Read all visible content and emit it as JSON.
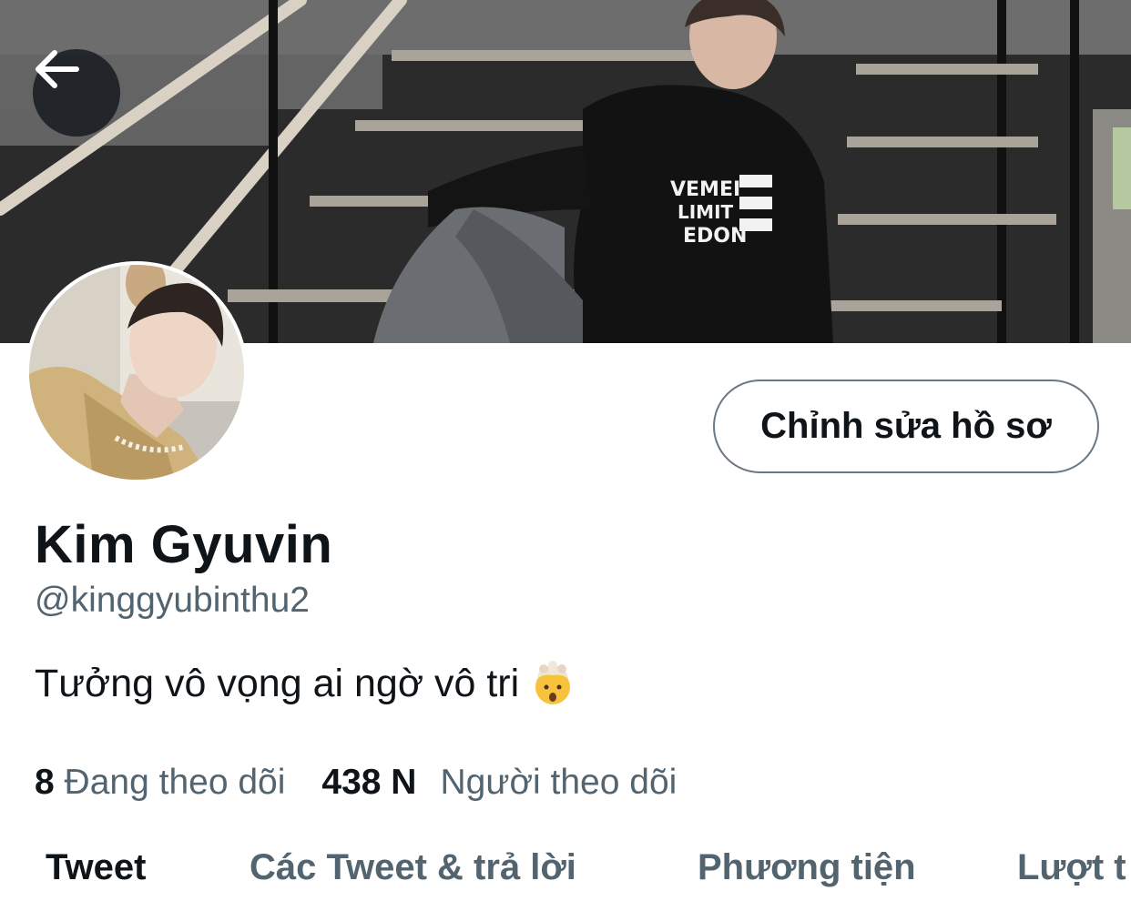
{
  "header": {
    "back_icon": "arrow-left-icon"
  },
  "profile": {
    "edit_button_label": "Chỉnh sửa hồ sơ",
    "display_name": "Kim Gyuvin",
    "handle": "@kinggyubinthu2",
    "bio": "Tưởng vô vọng ai ngờ vô tri",
    "bio_emoji_icon": "exploding-head-emoji",
    "following_count": "8",
    "following_label": "Đang theo dõi",
    "followers_count": "438 N",
    "followers_label": "Người theo dõi"
  },
  "tabs": [
    {
      "label": "Tweet",
      "active": true
    },
    {
      "label": "Các Tweet & trả lời",
      "active": false
    },
    {
      "label": "Phương tiện",
      "active": false
    },
    {
      "label": "Lượt t",
      "active": false
    }
  ],
  "colors": {
    "primary_text": "#0f1419",
    "secondary_text": "#536471",
    "button_border": "#6b7884"
  }
}
